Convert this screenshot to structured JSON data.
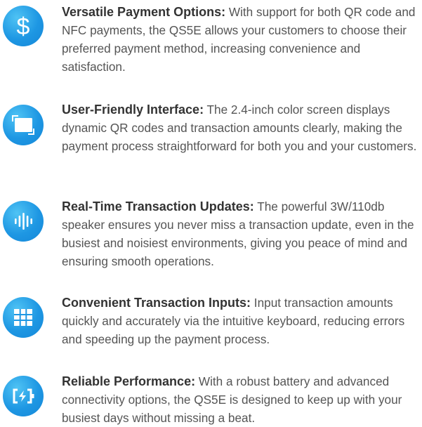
{
  "accent_color": "#1e97e3",
  "features": [
    {
      "icon": "dollar-icon",
      "title": "Versatile Payment Options:",
      "body": " With support for both QR code and NFC payments, the QS5E allows your customers to choose their preferred payment method, increasing convenience and satisfaction."
    },
    {
      "icon": "screen-icon",
      "title": "User-Friendly Interface:",
      "body": " The 2.4-inch color screen displays dynamic QR codes and transaction amounts clearly, making the payment process straightforward for both you and your customers."
    },
    {
      "icon": "sound-wave-icon",
      "title": "Real-Time Transaction Updates:",
      "body": " The powerful 3W/110db speaker ensures you never miss a transaction update, even in the busiest and noisiest environments, giving you peace of mind and ensuring smooth operations."
    },
    {
      "icon": "keypad-icon",
      "title": "Convenient Transaction Inputs:",
      "body": " Input transaction amounts quickly and accurately via the intuitive keyboard, reducing errors and speeding up the payment process."
    },
    {
      "icon": "battery-charging-icon",
      "title": "Reliable Performance:",
      "body": " With a robust battery and advanced connectivity options, the QS5E is designed to keep up with your busiest days without missing a beat."
    }
  ]
}
